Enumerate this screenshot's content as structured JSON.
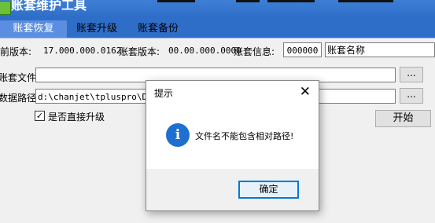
{
  "window": {
    "title": "账套维护工具"
  },
  "tabs": [
    {
      "label": "账套恢复"
    },
    {
      "label": "账套升级"
    },
    {
      "label": "账套备份"
    }
  ],
  "info_row": {
    "current_version_label": "当前版本:",
    "current_version_value": "17.000.000.0162",
    "account_version_label": "账套版本:",
    "account_version_value": "00.00.000.0000",
    "account_info_label": "账套信息:",
    "account_code": "000000",
    "account_name": "账套名称"
  },
  "account_file": {
    "label": "账套文件",
    "value": "",
    "browse_label": "..."
  },
  "data_path": {
    "label": "数据路径",
    "value": "d:\\chanjet\\tpluspro\\DBSe",
    "browse_label": "..."
  },
  "direct_upgrade": {
    "label": "是否直接升级",
    "checked": true
  },
  "start_button": {
    "label": "开始"
  },
  "dialog": {
    "title": "提示",
    "close_glyph": "✕",
    "icon_glyph": "i",
    "message": "文件名不能包含相对路径!",
    "ok_label": "确定"
  },
  "colors": {
    "title_bar": "#2f6ec8",
    "active_tab": "#5b8ee0",
    "dialog_focus_border": "#0078d7",
    "info_icon": "#1e6fd0"
  }
}
